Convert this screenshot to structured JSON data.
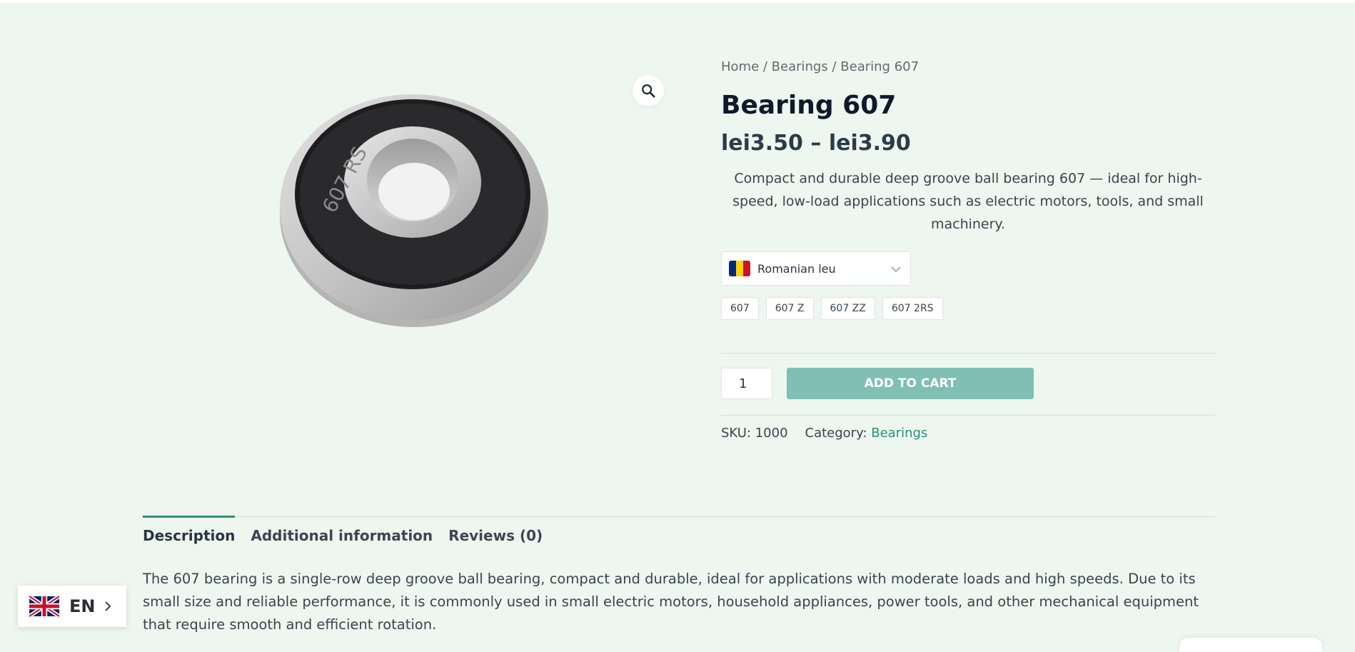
{
  "breadcrumb": {
    "home": "Home",
    "sep1": " / ",
    "category": "Bearings",
    "sep2": " / ",
    "current": "Bearing 607"
  },
  "product": {
    "title": "Bearing 607",
    "price_range": "lei3.50 – lei3.90",
    "short_description": "Compact and durable deep groove ball bearing 607 — ideal for high-speed, low-load applications such as electric motors, tools, and small machinery.",
    "variations": [
      "607",
      "607 Z",
      "607 ZZ",
      "607 2RS"
    ],
    "quantity": "1",
    "add_to_cart_label": "ADD TO CART",
    "sku_label": "SKU: 1000",
    "category_label": "Category:",
    "category_value": "Bearings",
    "image_text": "607 RS"
  },
  "currency": {
    "selected": "Romanian leu",
    "flag_colors": [
      "#002b7f",
      "#fcd116",
      "#ce1126"
    ]
  },
  "tabs": [
    {
      "label": "Description",
      "active": true
    },
    {
      "label": "Additional information",
      "active": false
    },
    {
      "label": "Reviews (0)",
      "active": false
    }
  ],
  "description": "The 607 bearing is a single-row deep groove ball bearing, compact and durable, ideal for applications with moderate loads and high speeds. Due to its small size and reliable performance, it is commonly used in small electric motors, household appliances, power tools, and other mechanical equipment that require smooth and efficient rotation.",
  "language": {
    "code": "EN",
    "icon": "uk-flag-icon"
  },
  "colors": {
    "background": "#edf6ef",
    "accent": "#2b8f7f",
    "button": "#80bfb4"
  }
}
